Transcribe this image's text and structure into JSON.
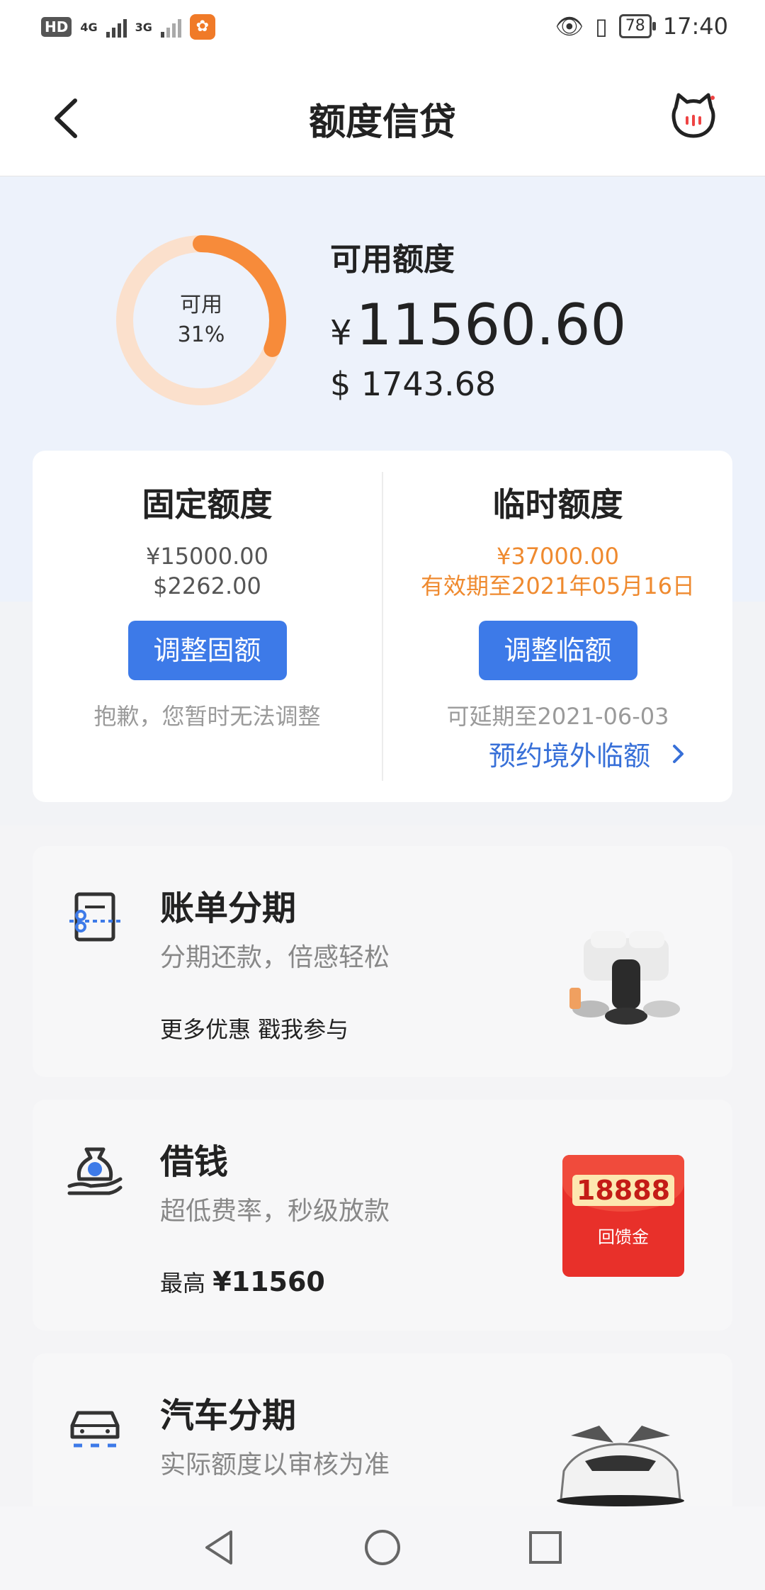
{
  "status_bar": {
    "time": "17:40",
    "hd_label": "HD",
    "network_1": "4G",
    "network_2": "3G",
    "battery": "78"
  },
  "header": {
    "title": "额度信贷"
  },
  "available": {
    "donut_label": "可用",
    "donut_percent": "31%",
    "donut_fraction": 0.31,
    "label": "可用额度",
    "yen_symbol": "¥",
    "amount_cny": "11560.60",
    "amount_usd": "$ 1743.68"
  },
  "fixed_quota": {
    "title": "固定额度",
    "cny": "¥15000.00",
    "usd": "$2262.00",
    "button": "调整固额",
    "note": "抱歉，您暂时无法调整"
  },
  "temp_quota": {
    "title": "临时额度",
    "cny": "¥37000.00",
    "validity": "有效期至2021年05月16日",
    "button": "调整临额",
    "note": "可延期至2021-06-03",
    "link": "预约境外临额"
  },
  "features": [
    {
      "title": "账单分期",
      "subtitle": "分期还款，倍感轻松",
      "extra": "更多优惠 戳我参与"
    },
    {
      "title": "借钱",
      "subtitle": "超低费率，秒级放款",
      "extra_prefix": "最高",
      "extra_value": "¥11560",
      "badge_number": "18888",
      "badge_label": "回馈金"
    },
    {
      "title": "汽车分期",
      "subtitle": "实际额度以审核为准"
    }
  ],
  "colors": {
    "accent_blue": "#3d7ae8",
    "orange": "#ef8a2f",
    "donut_track": "#fbe0cc",
    "donut_fill": "#f78b3a"
  },
  "icons": {
    "back": "chevron-left-icon",
    "mascot": "cat-mascot-icon",
    "bill": "bill-scissors-icon",
    "loan": "money-bag-icon",
    "car": "car-icon"
  }
}
